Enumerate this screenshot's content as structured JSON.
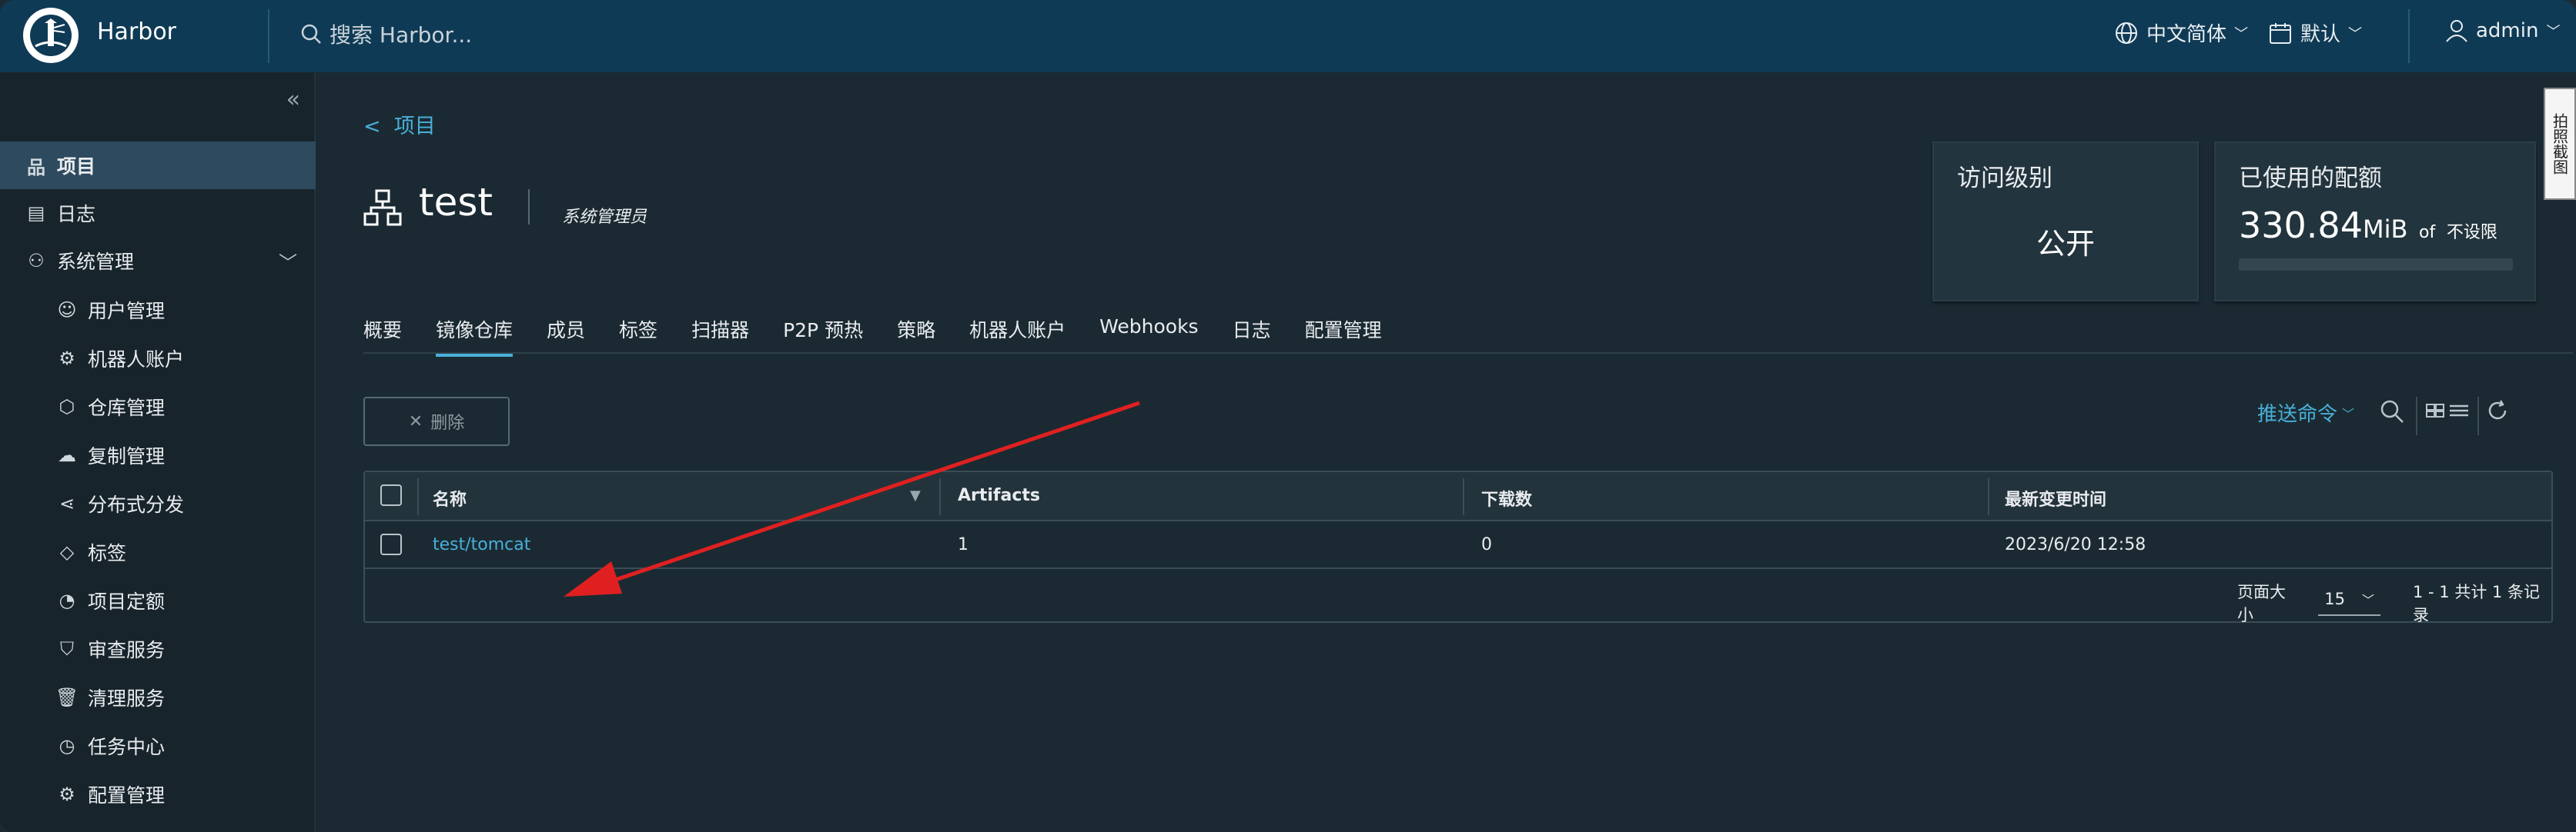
{
  "header": {
    "app_title": "Harbor",
    "search_placeholder": "搜索 Harbor...",
    "language": "中文简体",
    "datetime_format": "默认",
    "user": "admin"
  },
  "sidebar": {
    "items": [
      {
        "label": "项目",
        "icon": "project-icon",
        "active": true
      },
      {
        "label": "日志",
        "icon": "logs-icon"
      },
      {
        "label": "系统管理",
        "icon": "admin-icon",
        "expanded": true
      },
      {
        "label": "用户管理",
        "icon": "users-icon"
      },
      {
        "label": "机器人账户",
        "icon": "robot-icon"
      },
      {
        "label": "仓库管理",
        "icon": "registry-icon"
      },
      {
        "label": "复制管理",
        "icon": "replication-icon"
      },
      {
        "label": "分布式分发",
        "icon": "distribution-icon"
      },
      {
        "label": "标签",
        "icon": "tag-icon"
      },
      {
        "label": "项目定额",
        "icon": "quota-icon"
      },
      {
        "label": "审查服务",
        "icon": "shield-icon"
      },
      {
        "label": "清理服务",
        "icon": "trash-icon"
      },
      {
        "label": "任务中心",
        "icon": "dashboard-icon"
      },
      {
        "label": "配置管理",
        "icon": "gear-icon"
      }
    ]
  },
  "main": {
    "breadcrumb": "项目",
    "project_name": "test",
    "role": "系统管理员",
    "access_card": {
      "label": "访问级别",
      "value": "公开"
    },
    "quota_card": {
      "label": "已使用的配额",
      "value": "330.84",
      "unit": "MiB",
      "of": "of",
      "limit": "不设限"
    },
    "tabs": [
      "概要",
      "镜像仓库",
      "成员",
      "标签",
      "扫描器",
      "P2P 预热",
      "策略",
      "机器人账户",
      "Webhooks",
      "日志",
      "配置管理"
    ],
    "active_tab": "镜像仓库",
    "delete_label": "删除",
    "push_command_label": "推送命令",
    "table": {
      "columns": [
        "名称",
        "Artifacts",
        "下载数",
        "最新变更时间"
      ],
      "rows": [
        {
          "name": "test/tomcat",
          "artifacts": "1",
          "downloads": "0",
          "updated": "2023/6/20 12:58"
        }
      ],
      "page_size_label": "页面大小",
      "page_size": "15",
      "summary": "1 - 1 共计 1 条记录"
    }
  },
  "side_tab_label": "拍照截图",
  "colors": {
    "accent": "#49afd9",
    "header_bg": "#0f3a55",
    "sidebar_active": "#2d4a5e",
    "arrow": "#e02020"
  }
}
